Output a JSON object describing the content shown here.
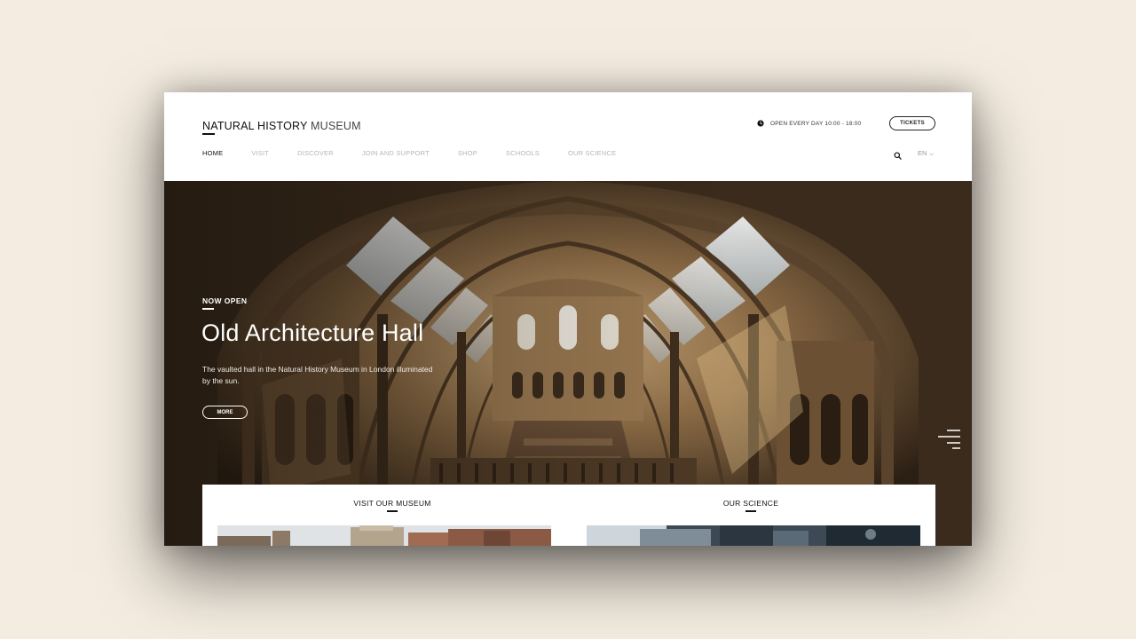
{
  "header": {
    "logo_main": "NATURAL HISTORY",
    "logo_sub": "MUSEUM",
    "hours": "OPEN EVERY DAY 10:00 - 18:00",
    "tickets_label": "TICKETS",
    "language": "EN"
  },
  "nav": {
    "items": [
      {
        "label": "HOME",
        "active": true
      },
      {
        "label": "VISIT",
        "active": false
      },
      {
        "label": "DISCOVER",
        "active": false
      },
      {
        "label": "JOIN AND SUPPORT",
        "active": false
      },
      {
        "label": "SHOP",
        "active": false
      },
      {
        "label": "SCHOOLS",
        "active": false
      },
      {
        "label": "OUR SCIENCE",
        "active": false
      }
    ]
  },
  "hero": {
    "eyebrow": "NOW OPEN",
    "title": "Old Architecture Hall",
    "description": "The vaulted hall in the Natural History Museum in London illuminated by the sun.",
    "more_label": "MORE"
  },
  "cards": [
    {
      "title": "VISIT OUR MUSEUM"
    },
    {
      "title": "OUR SCIENCE"
    }
  ],
  "icons": {
    "clock": "clock-icon",
    "search": "search-icon",
    "language_chevron": "chevron-down-icon",
    "menu": "menu-icon"
  },
  "colors": {
    "page_background": "#f4ece0",
    "text_dark": "#111111",
    "nav_inactive": "#b5b5b5"
  }
}
